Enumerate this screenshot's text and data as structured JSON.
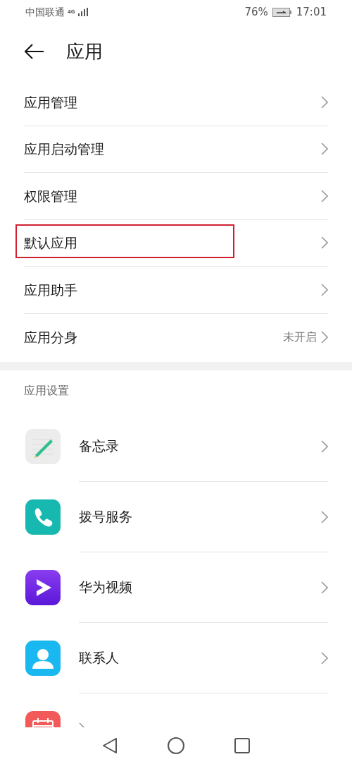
{
  "status_bar": {
    "carrier": "中国联通",
    "network": "4G",
    "battery": "76%",
    "time": "17:01"
  },
  "header": {
    "title": "应用"
  },
  "menu_items": [
    {
      "label": "应用管理",
      "highlighted": false
    },
    {
      "label": "应用启动管理",
      "highlighted": false
    },
    {
      "label": "权限管理",
      "highlighted": false
    },
    {
      "label": "默认应用",
      "highlighted": true
    },
    {
      "label": "应用助手",
      "highlighted": false
    },
    {
      "label": "应用分身",
      "value": "未开启",
      "highlighted": false
    }
  ],
  "section": {
    "title": "应用设置"
  },
  "apps": [
    {
      "kind": "notes",
      "label": "备忘录"
    },
    {
      "kind": "phone",
      "label": "拨号服务"
    },
    {
      "kind": "video",
      "label": "华为视频"
    },
    {
      "kind": "contacts",
      "label": "联系人"
    },
    {
      "kind": "calendar"
    }
  ]
}
